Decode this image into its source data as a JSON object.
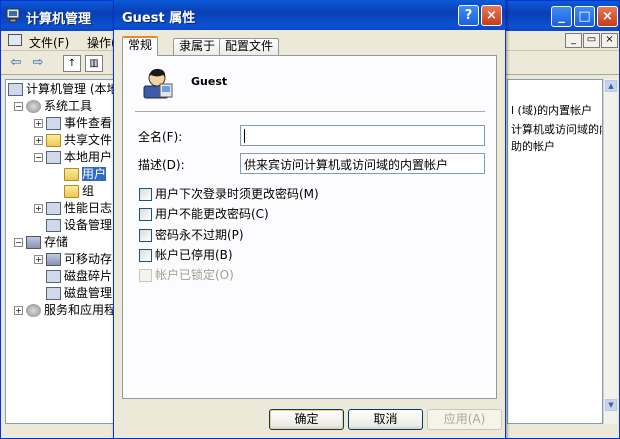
{
  "bg_window": {
    "title": "计算机管理",
    "menu": {
      "file": "文件(F)",
      "action": "操作("
    },
    "caption_buttons": [
      "_",
      "□",
      "×"
    ],
    "mdi_buttons": [
      "_",
      "▭",
      "×"
    ],
    "tree": [
      {
        "label": "计算机管理 (本地",
        "expander": "",
        "icon": "computer-icon"
      },
      {
        "label": "系统工具",
        "expander": "−",
        "icon": "tools-icon"
      },
      {
        "label": "事件查看",
        "expander": "+",
        "icon": "event-viewer-icon"
      },
      {
        "label": "共享文件",
        "expander": "+",
        "icon": "folder-icon"
      },
      {
        "label": "本地用户",
        "expander": "−",
        "icon": "users-icon"
      },
      {
        "label": "用户",
        "expander": "",
        "icon": "folder-icon"
      },
      {
        "label": "组",
        "expander": "",
        "icon": "folder-icon"
      },
      {
        "label": "性能日志",
        "expander": "+",
        "icon": "performance-icon"
      },
      {
        "label": "设备管理",
        "expander": "",
        "icon": "device-icon"
      },
      {
        "label": "存储",
        "expander": "−",
        "icon": "storage-icon"
      },
      {
        "label": "可移动存",
        "expander": "+",
        "icon": "removable-icon"
      },
      {
        "label": "磁盘碎片",
        "expander": "",
        "icon": "defrag-icon"
      },
      {
        "label": "磁盘管理",
        "expander": "",
        "icon": "disk-icon"
      },
      {
        "label": "服务和应用程",
        "expander": "+",
        "icon": "services-icon"
      }
    ],
    "right_lines": [
      "l (域)的内置帐户",
      "计算机或访问域的内",
      "助的帐户"
    ]
  },
  "dialog": {
    "title": "Guest 属性",
    "help_button": "?",
    "close_button": "×",
    "tabs": [
      "常规",
      "隶属于",
      "配置文件"
    ],
    "username": "Guest",
    "fullname_label": "全名(F):",
    "fullname_value": "",
    "description_label": "描述(D):",
    "description_value": "供来宾访问计算机或访问域的内置帐户",
    "checkboxes": [
      {
        "label": "用户下次登录时须更改密码(M)",
        "checked": false,
        "enabled": true
      },
      {
        "label": "用户不能更改密码(C)",
        "checked": false,
        "enabled": true
      },
      {
        "label": "密码永不过期(P)",
        "checked": false,
        "enabled": true
      },
      {
        "label": "帐户已停用(B)",
        "checked": false,
        "enabled": true
      },
      {
        "label": "帐户已锁定(O)",
        "checked": false,
        "enabled": false
      }
    ],
    "buttons": {
      "ok": "确定",
      "cancel": "取消",
      "apply": "应用(A)"
    }
  }
}
